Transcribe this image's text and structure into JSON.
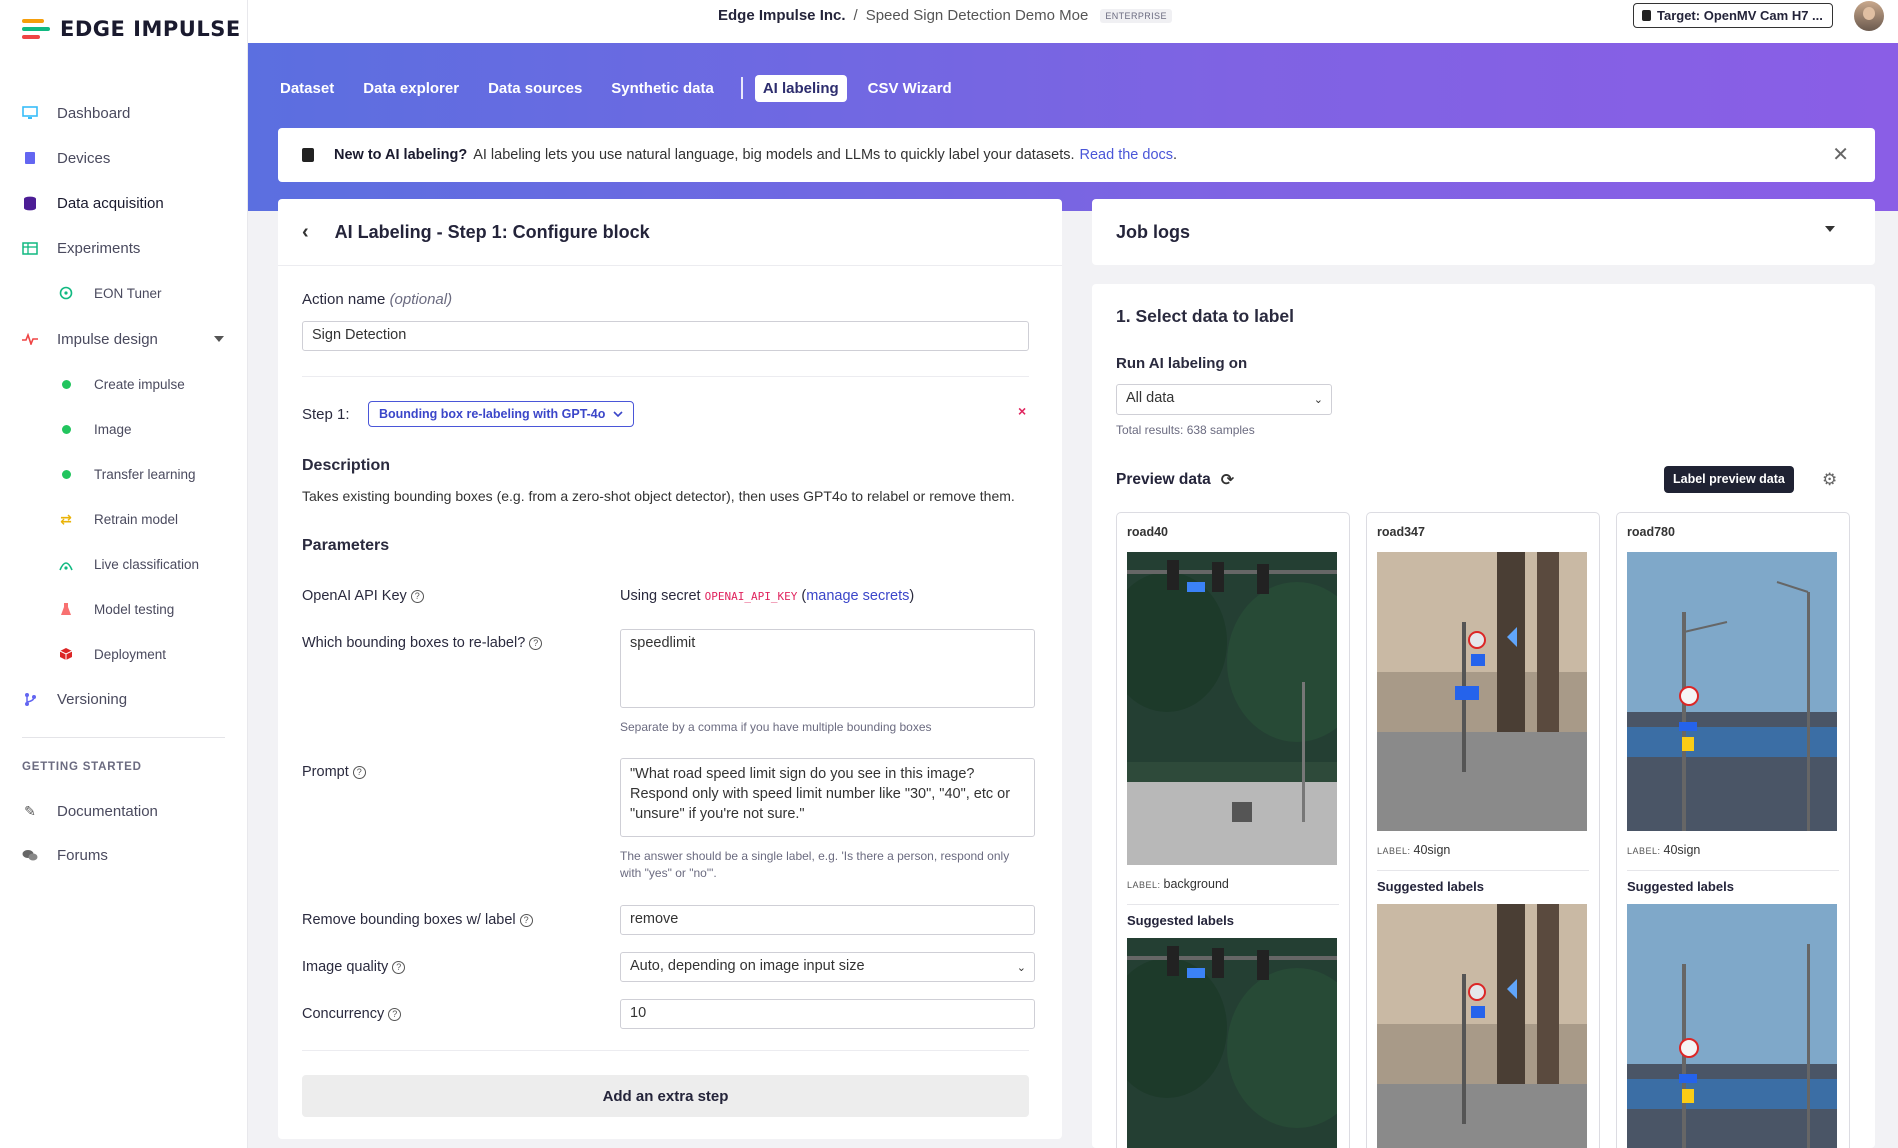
{
  "brand": {
    "name": "EDGE IMPULSE",
    "colors": [
      "#f59e0b",
      "#10b981",
      "#ef4444"
    ]
  },
  "sidebar": {
    "items": [
      {
        "label": "Dashboard",
        "icon": "monitor-icon"
      },
      {
        "label": "Devices",
        "icon": "chip-icon"
      },
      {
        "label": "Data acquisition",
        "icon": "database-icon"
      },
      {
        "label": "Experiments",
        "icon": "table-icon"
      },
      {
        "label": "EON Tuner",
        "icon": "compass-icon"
      },
      {
        "label": "Impulse design",
        "icon": "pulse-icon"
      },
      {
        "label": "Create impulse",
        "icon": "green-dot-icon"
      },
      {
        "label": "Image",
        "icon": "green-dot-icon"
      },
      {
        "label": "Transfer learning",
        "icon": "green-dot-icon"
      },
      {
        "label": "Retrain model",
        "icon": "shuffle-icon"
      },
      {
        "label": "Live classification",
        "icon": "signal-icon"
      },
      {
        "label": "Model testing",
        "icon": "flask-icon"
      },
      {
        "label": "Deployment",
        "icon": "cube-icon"
      },
      {
        "label": "Versioning",
        "icon": "branch-icon"
      }
    ],
    "section": "GETTING STARTED",
    "extra": [
      {
        "label": "Documentation",
        "icon": "docs-icon"
      },
      {
        "label": "Forums",
        "icon": "chat-icon"
      }
    ]
  },
  "topbar": {
    "org": "Edge Impulse Inc.",
    "sep": "/",
    "project": "Speed Sign Detection Demo Moe",
    "badge": "ENTERPRISE",
    "target": "Target: OpenMV Cam H7 ..."
  },
  "tabs": [
    "Dataset",
    "Data explorer",
    "Data sources",
    "Synthetic data",
    "AI labeling",
    "CSV Wizard"
  ],
  "banner": {
    "bold": "New to AI labeling?",
    "text": "AI labeling lets you use natural language, big models and LLMs to quickly label your datasets.",
    "link": "Read the docs",
    "after": "."
  },
  "config": {
    "title": "AI Labeling - Step 1: Configure block",
    "action_label": "Action name",
    "action_optional": "(optional)",
    "action_value": "Sign Detection",
    "step_label": "Step 1:",
    "step_value": "Bounding box re-labeling with GPT-4o",
    "description_title": "Description",
    "description": "Takes existing bounding boxes (e.g. from a zero-shot object detector), then uses GPT4o to relabel or remove them.",
    "parameters_title": "Parameters",
    "api_key_label": "OpenAI API Key",
    "api_key_prefix": "Using secret",
    "api_key_secret": "OPENAI_API_KEY",
    "api_key_open": "(",
    "api_key_link": "manage secrets",
    "api_key_close": ")",
    "which_label": "Which bounding boxes to re-label?",
    "which_value": "speedlimit",
    "which_help": "Separate by a comma if you have multiple bounding boxes",
    "prompt_label": "Prompt",
    "prompt_value": "\"What road speed limit sign do you see in this image? Respond only with speed limit number like \"30\", \"40\", etc or \"unsure\" if you're not sure.\"",
    "prompt_help": "The answer should be a single label, e.g. 'Is there a person, respond only with \"yes\" or \"no\"'.",
    "remove_label": "Remove bounding boxes w/ label",
    "remove_value": "remove",
    "quality_label": "Image quality",
    "quality_value": "Auto, depending on image input size",
    "concurrency_label": "Concurrency",
    "concurrency_value": "10",
    "add_step": "Add an extra step"
  },
  "job_logs": {
    "title": "Job logs"
  },
  "select": {
    "title": "1. Select data to label",
    "run_label": "Run AI labeling on",
    "run_value": "All data",
    "total": "Total results: 638 samples",
    "preview_title": "Preview data",
    "label_btn": "Label preview data",
    "samples": [
      {
        "name": "road40",
        "label_key": "LABEL:",
        "label": "background",
        "suggested": "Suggested labels"
      },
      {
        "name": "road347",
        "label_key": "LABEL:",
        "label": "40sign",
        "suggested": "Suggested labels"
      },
      {
        "name": "road780",
        "label_key": "LABEL:",
        "label": "40sign",
        "suggested": "Suggested labels"
      }
    ]
  }
}
